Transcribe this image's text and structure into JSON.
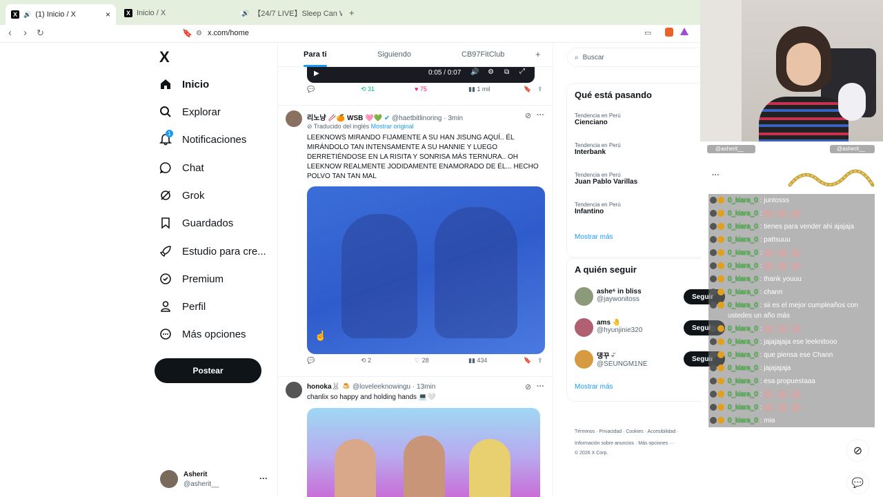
{
  "browser": {
    "tabs": [
      {
        "title": "(1) Inicio / X"
      },
      {
        "title": "Inicio / X"
      },
      {
        "title": "【24/7 LIVE】Sleep Can Wait. — Vi..."
      }
    ],
    "new_tab": "+",
    "url": "x.com/home"
  },
  "sidebar": {
    "logo": "X",
    "items": [
      {
        "label": "Inicio",
        "icon": "home-icon"
      },
      {
        "label": "Explorar",
        "icon": "search-icon"
      },
      {
        "label": "Notificaciones",
        "icon": "bell-icon",
        "badge": "1"
      },
      {
        "label": "Chat",
        "icon": "chat-icon"
      },
      {
        "label": "Grok",
        "icon": "grok-icon"
      },
      {
        "label": "Guardados",
        "icon": "bookmark-icon"
      },
      {
        "label": "Estudio para cre...",
        "icon": "rocket-icon"
      },
      {
        "label": "Premium",
        "icon": "verified-icon"
      },
      {
        "label": "Perfil",
        "icon": "person-icon"
      },
      {
        "label": "Más opciones",
        "icon": "more-circle-icon"
      }
    ],
    "post_button": "Postear",
    "account": {
      "name": "Asherit",
      "handle": "@asherit__"
    }
  },
  "timeline": {
    "tabs": [
      "Para ti",
      "Siguiendo",
      "CB97FitClub"
    ],
    "add_tab": "+",
    "video_time": "0:05 / 0:07",
    "post0_actions": {
      "retweets": "31",
      "likes": "75",
      "views": "1 mil"
    },
    "post1": {
      "name": "리노냥 🥢🍊 WSB 🩷💚",
      "handle": "@haetbitlinoring",
      "time": "3min",
      "translated": "Traducido del inglés",
      "show_original": "Mostrar original",
      "text": "LEEKNOWS MIRANDO FIJAMENTE A SU HAN JISUNG AQUÍ.. ÉL MIRÁNDOLO TAN INTENSAMENTE A SU HANNIE Y LUEGO DERRETIÉNDOSE EN LA RISITA Y SONRISA MÁS TERNURA.. OH LEEKNOW REALMENTE JODIDAMENTE ENAMORADO DE ÉL... HECHO POLVO TAN TAN MAL",
      "retweets": "2",
      "likes": "28",
      "views": "434"
    },
    "post2": {
      "name": "honoka🐰 🍮",
      "handle": "@loveleeknowingu",
      "time": "13min",
      "text": "chanlix so happy and holding hands 💻🤍"
    }
  },
  "right": {
    "search_placeholder": "Buscar",
    "trends_title": "Qué está pasando",
    "trends": [
      {
        "sub": "Tendencia en Perú",
        "name": "Cienciano"
      },
      {
        "sub": "Tendencia en Perú",
        "name": "Interbank"
      },
      {
        "sub": "Tendencia en Perú",
        "name": "Juan Pablo Varillas"
      },
      {
        "sub": "Tendencia en Perú",
        "name": "Infantino"
      }
    ],
    "show_more": "Mostrar más",
    "follow_title": "A quién seguir",
    "follows": [
      {
        "name": "ashe⁶ in bliss",
        "handle": "@jaywonitoss"
      },
      {
        "name": "ams 🤚",
        "handle": "@hyunjinie320"
      },
      {
        "name": "댕꾸 ᵕ̈",
        "handle": "@SEUNGM1NE"
      }
    ],
    "follow_label": "Seguir",
    "show_more2": "Mostrar más",
    "footer1": [
      "Términos",
      "Privacidad",
      "Cookies",
      "Accesibilidad"
    ],
    "footer2": [
      "Información sobre anuncios",
      "Más opciones ···"
    ],
    "copyright": "© 2026 X Corp."
  },
  "stream": {
    "names": [
      "@asherit__",
      "@asherit__"
    ],
    "chat": [
      {
        "user": "0_kiara_0",
        "msg": "juntosss"
      },
      {
        "user": "0_kiara_0",
        "msg": ""
      },
      {
        "user": "0_kiara_0",
        "msg": "tienes para vender ahi ajajaja"
      },
      {
        "user": "0_kiara_0",
        "msg": "pattsuuu"
      },
      {
        "user": "0_kiara_0",
        "msg": ""
      },
      {
        "user": "0_kiara_0",
        "msg": ""
      },
      {
        "user": "0_kiara_0",
        "msg": "thank youuu"
      },
      {
        "user": "0_kiara_0",
        "msg": "chann"
      },
      {
        "user": "0_kiara_0",
        "msg": "sii es el mejor cumpleaños con ustedes un año más"
      },
      {
        "user": "0_kiara_0",
        "msg": ""
      },
      {
        "user": "0_kiara_0",
        "msg": "jajajajaja ese leeknitooo"
      },
      {
        "user": "0_kiara_0",
        "msg": "que piensa ese Chann"
      },
      {
        "user": "0_kiara_0",
        "msg": "jajajajaja"
      },
      {
        "user": "0_kiara_0",
        "msg": "esa propuestaaa"
      },
      {
        "user": "0_kiara_0",
        "msg": ""
      },
      {
        "user": "0_kiara_0",
        "msg": ""
      },
      {
        "user": "0_kiara_0",
        "msg": "mia"
      }
    ]
  },
  "colors": {
    "like": "#f91880",
    "retweet": "#00ba7c",
    "link": "#1d9bf0",
    "chat_name": "#3de03d"
  }
}
